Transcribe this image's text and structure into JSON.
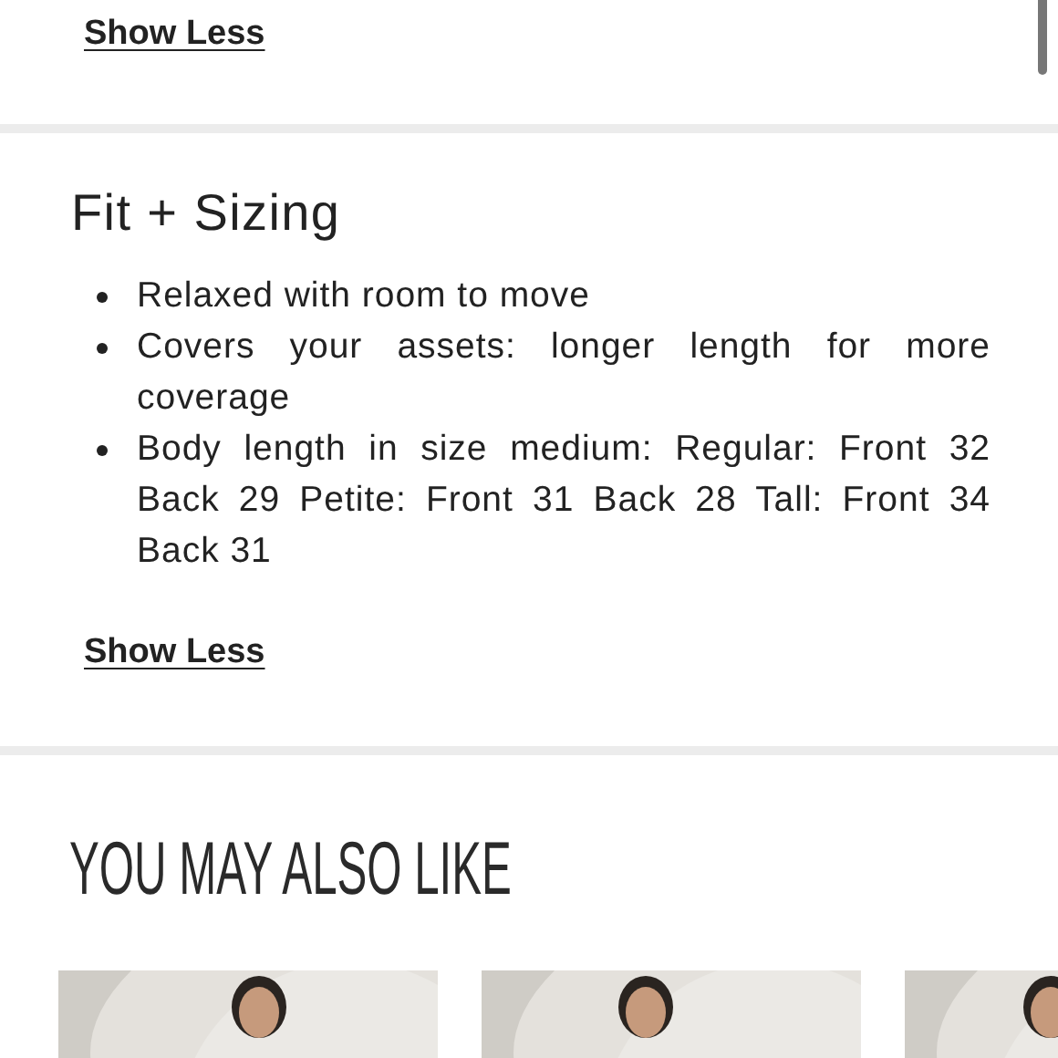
{
  "top_section": {
    "toggle": "Show Less"
  },
  "fit_section": {
    "title": "Fit + Sizing",
    "bullets": [
      "Relaxed with room to move",
      "Covers your assets: longer length for more coverage",
      "Body length in size medium: Regular: Front 32 Back 29 Petite: Front 31 Back 28 Tall: Front 34 Back 31"
    ],
    "toggle": "Show Less"
  },
  "recommendations": {
    "title": "YOU MAY ALSO LIKE"
  }
}
